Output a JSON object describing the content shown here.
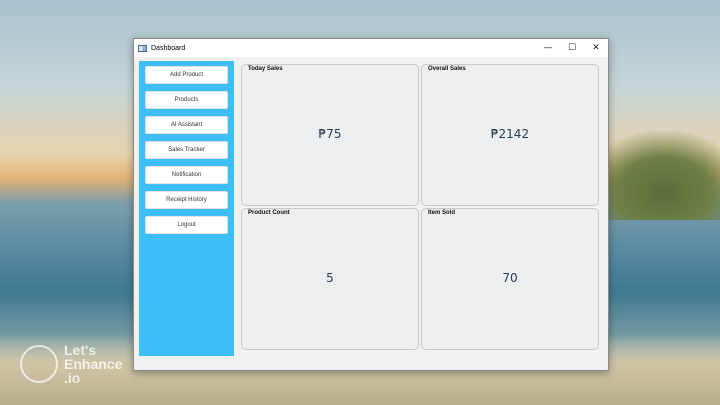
{
  "window": {
    "title": "Dashboard",
    "minimize_icon": "minimize-icon",
    "maximize_icon": "maximize-icon",
    "close_icon": "close-icon",
    "minimize_glyph": "—",
    "maximize_glyph": "☐",
    "close_glyph": "✕"
  },
  "sidebar": {
    "color": "#3bbff5",
    "items": [
      {
        "label": "Add Product"
      },
      {
        "label": "Products"
      },
      {
        "label": "AI Assistant"
      },
      {
        "label": "Sales Tracker"
      },
      {
        "label": "Notification"
      },
      {
        "label": "Receipt History"
      },
      {
        "label": "Logout"
      }
    ]
  },
  "cards": [
    {
      "title": "Today Sales",
      "value": "₱75"
    },
    {
      "title": "Overall Sales",
      "value": "₱2142"
    },
    {
      "title": "Product Count",
      "value": "5"
    },
    {
      "title": "Item Sold",
      "value": "70"
    }
  ],
  "watermark": {
    "text": "Let's\nEnhance\n.io"
  }
}
